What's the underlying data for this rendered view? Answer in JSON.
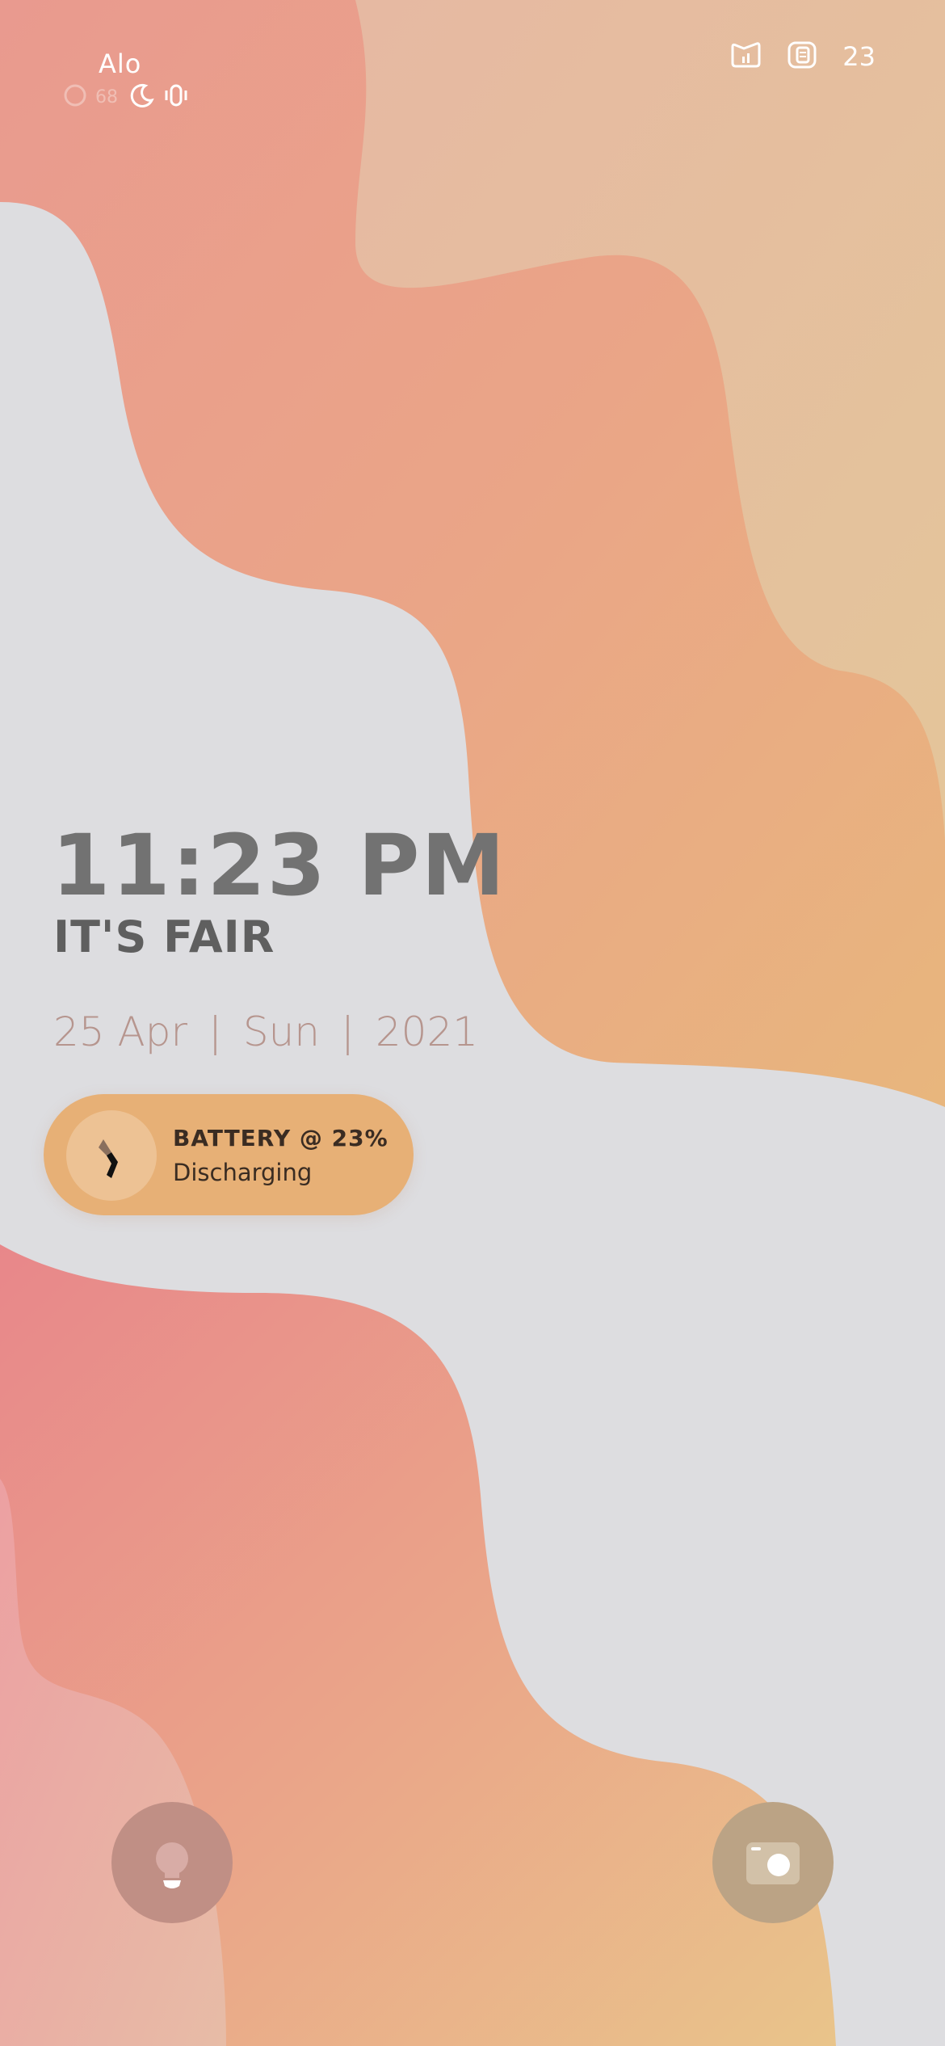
{
  "status_bar": {
    "carrier": "Alo",
    "right_number": "23",
    "left_icons": [
      "circle-icon",
      "carrier-small-icon",
      "moon-icon",
      "vibrate-icon"
    ],
    "right_icons": [
      "signal-icon",
      "battery-card-icon"
    ]
  },
  "lockscreen": {
    "time": "11:23 PM",
    "weather": "IT'S FAIR",
    "date": {
      "day_month": "25 Apr",
      "separator": "|",
      "weekday": "Sun",
      "year": "2021"
    }
  },
  "battery": {
    "title": "BATTERY @ 23%",
    "status": "Discharging",
    "level_percent": 23,
    "icon": "lightning-icon"
  },
  "shortcuts": {
    "left": "flashlight-icon",
    "right": "camera-icon"
  },
  "colors": {
    "card": "#e7b076",
    "clock": "#727272",
    "weather": "#5f5f5f",
    "date": "#b6958e",
    "flashlight_button": "#c08f85",
    "camera_button": "#bba385"
  }
}
